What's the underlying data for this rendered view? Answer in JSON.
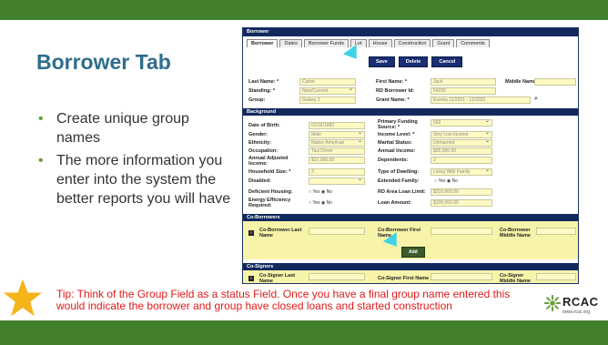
{
  "slide": {
    "title": "Borrower Tab",
    "bullets": [
      "Create unique group names",
      "The more information you enter into the system the better reports you will have"
    ],
    "tip": "Tip: Think of the Group Field as a status Field.  Once you have a final group name entered this would indicate the borrower and group have closed loans and started construction",
    "logo": {
      "name": "RCAC",
      "url": "www.rcac.org"
    },
    "colors": {
      "bar": "#43802d",
      "title": "#2f6d8c",
      "tip": "#e01a1a",
      "star": "#f4b41a"
    }
  },
  "form": {
    "header": "Borrower",
    "tabs": [
      "Borrower",
      "Dates",
      "Borrower Funds",
      "Lot",
      "House",
      "Construction",
      "Grant",
      "Comments"
    ],
    "buttons": {
      "save": "Save",
      "delete": "Delete",
      "cancel": "Cancel"
    },
    "top_fields": {
      "last_name_label": "Last Name: *",
      "last_name_value": "Carter",
      "first_name_label": "First Name: *",
      "first_name_value": "Jack",
      "middle_name_label": "Middle Name:",
      "standing_label": "Standing: *",
      "standing_value": "New/Current",
      "rd_borrower_id_label": "RD Borrower Id:",
      "rd_borrower_id_value": "54326",
      "group_label": "Group:",
      "group_value": "Galaxy 1",
      "grant_name_label": "Grant Name: *",
      "grant_name_value": "Eureka 11/2021 - 11/2023"
    },
    "background": {
      "section": "Background",
      "dob_label": "Date of Birth:",
      "dob_value": "01/18/1982",
      "primary_funding_label": "Primary Funding Source: *",
      "primary_funding_value": "502",
      "gender_label": "Gender:",
      "gender_value": "Male",
      "income_level_label": "Income Level: *",
      "income_level_value": "Very Low Income",
      "ethnicity_label": "Ethnicity:",
      "ethnicity_value": "Native American",
      "marital_label": "Marital Status:",
      "marital_value": "Unmarried",
      "occupation_label": "Occupation:",
      "occupation_value": "Taxi Driver",
      "annual_income_label": "Annual Income:",
      "annual_income_value": "$25,000.00",
      "adj_income_label": "Annual Adjusted Income:",
      "adj_income_value": "$22,000.00",
      "dependents_label": "Dependents:",
      "dependents_value": "2",
      "household_label": "Household Size: *",
      "household_value": "3",
      "dwelling_label": "Type of Dwelling:",
      "dwelling_value": "Living With Family",
      "disabled_label": "Disabled:",
      "extended_family_label": "Extended Family:",
      "deficient_housing_label": "Deficient Housing:",
      "rd_loan_limit_label": "RD Area Loan Limit:",
      "rd_loan_limit_value": "$210,000.00",
      "energy_label": "Energy Efficiency Required:",
      "loan_amount_label": "Loan Amount:",
      "loan_amount_value": "$100,000.00",
      "yes": "Yes",
      "no": "No"
    },
    "coborrowers": {
      "section": "Co-Borrowers",
      "last_name": "Co-Borrower Last Name",
      "first_name": "Co-Borrower First Name",
      "middle_name": "Co-Borrower Middle Name",
      "add": "Add"
    },
    "cosigners": {
      "section": "Co-Signers",
      "last_name": "Co-Signer Last Name",
      "first_name": "Co-Signer First Name",
      "middle_name": "Co-Signer Middle Name"
    }
  }
}
